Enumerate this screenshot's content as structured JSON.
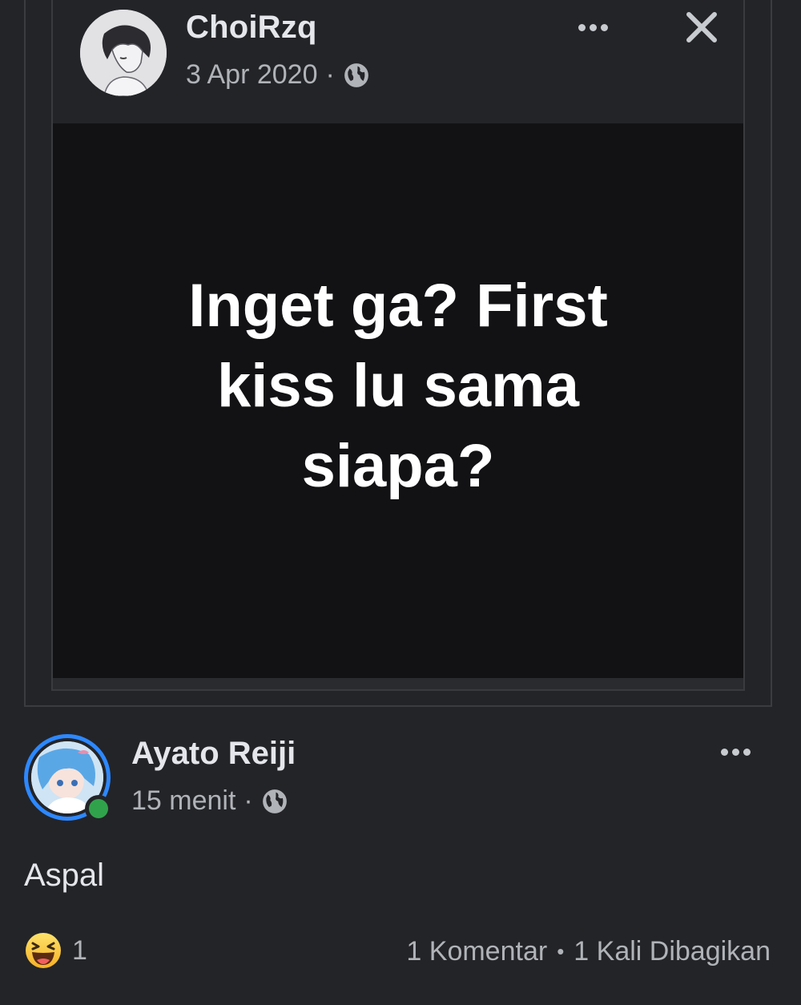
{
  "shared_post": {
    "author_name": "ChoiRzq",
    "date": "3 Apr 2020",
    "separator": "·",
    "privacy_icon": "globe-icon",
    "menu_icon": "more-dots-icon",
    "close_icon": "close-icon",
    "image_text": "Inget ga? First kiss lu sama siapa?"
  },
  "post": {
    "author_name": "Ayato Reiji",
    "time": "15 menit",
    "separator": "·",
    "privacy_icon": "globe-icon",
    "menu_icon": "more-dots-icon",
    "online_status_color": "#31a24c",
    "story_ring_color": "#2d88ff",
    "text": "Aspal",
    "reaction_icon": "haha-emoji-icon",
    "reaction_count": "1",
    "comments": "1 Komentar",
    "stats_separator": "•",
    "shares": "1 Kali Dibagikan"
  }
}
